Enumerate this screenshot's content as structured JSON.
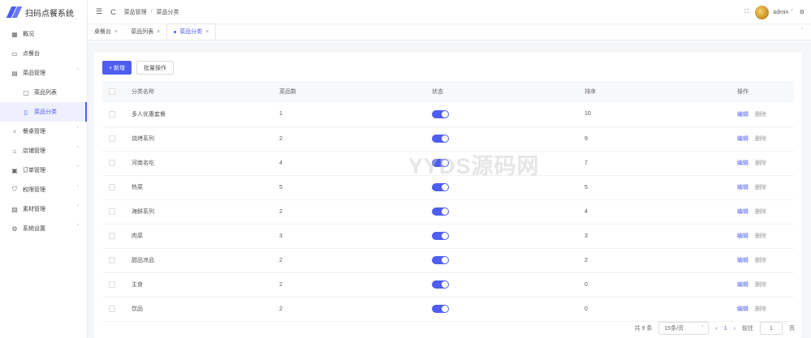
{
  "app": {
    "title": "扫码点餐系统"
  },
  "sidebar": {
    "items": [
      {
        "icon": "▦",
        "label": "概况",
        "chevron": ""
      },
      {
        "icon": "▭",
        "label": "点餐台",
        "chevron": ""
      },
      {
        "icon": "▤",
        "label": "菜品管理",
        "chevron": "ˆ"
      },
      {
        "icon": "▢",
        "label": "菜品列表",
        "chevron": ""
      },
      {
        "icon": "▯",
        "label": "菜品分类",
        "chevron": ""
      },
      {
        "icon": "♆",
        "label": "餐桌管理",
        "chevron": "ˇ"
      },
      {
        "icon": "⌂",
        "label": "店铺管理",
        "chevron": "ˇ"
      },
      {
        "icon": "▣",
        "label": "订单管理",
        "chevron": "ˇ"
      },
      {
        "icon": "⛉",
        "label": "权限管理",
        "chevron": "ˇ"
      },
      {
        "icon": "▨",
        "label": "素材管理",
        "chevron": "ˇ"
      },
      {
        "icon": "⚙",
        "label": "系统设置",
        "chevron": "ˇ"
      }
    ]
  },
  "header": {
    "menu_icon": "☰",
    "refresh_icon": "C",
    "breadcrumb": [
      "菜品管理",
      "菜品分类"
    ],
    "breadcrumb_sep": "/",
    "fullscreen_icon": "⛶",
    "user": "admin",
    "user_chevron": "ˇ",
    "settings_icon": "⚙"
  },
  "tabs": [
    {
      "label": "桌餐台",
      "close": "×"
    },
    {
      "label": "菜品列表",
      "close": "×"
    },
    {
      "label": "菜品分类",
      "close": "×"
    }
  ],
  "tabs_arrow": "ˇ",
  "toolbar": {
    "add_label": "+ 新增",
    "batch_label": "批量操作"
  },
  "table": {
    "headers": [
      "分类名称",
      "菜品数",
      "状态",
      "排序",
      "操作"
    ],
    "rows": [
      {
        "name": "多人优惠套餐",
        "count": "1",
        "sort": "10"
      },
      {
        "name": "烧烤系列",
        "count": "2",
        "sort": "9"
      },
      {
        "name": "河南名吃",
        "count": "4",
        "sort": "7"
      },
      {
        "name": "热菜",
        "count": "5",
        "sort": "5"
      },
      {
        "name": "海鲜系列",
        "count": "2",
        "sort": "4"
      },
      {
        "name": "肉菜",
        "count": "3",
        "sort": "3"
      },
      {
        "name": "甜品凉品",
        "count": "2",
        "sort": "2"
      },
      {
        "name": "主食",
        "count": "2",
        "sort": "0"
      },
      {
        "name": "饮品",
        "count": "2",
        "sort": "0"
      }
    ],
    "edit_label": "编辑",
    "delete_label": "删除"
  },
  "watermark": "YYDS源码网",
  "pagination": {
    "total": "共 9 条",
    "page_size": "15条/页",
    "page_size_chevron": "ˇ",
    "prev": "‹",
    "current": "1",
    "next": "›",
    "goto_label": "前往",
    "goto_value": "1",
    "goto_unit": "页"
  },
  "colors": {
    "primary": "#4f5df0"
  }
}
